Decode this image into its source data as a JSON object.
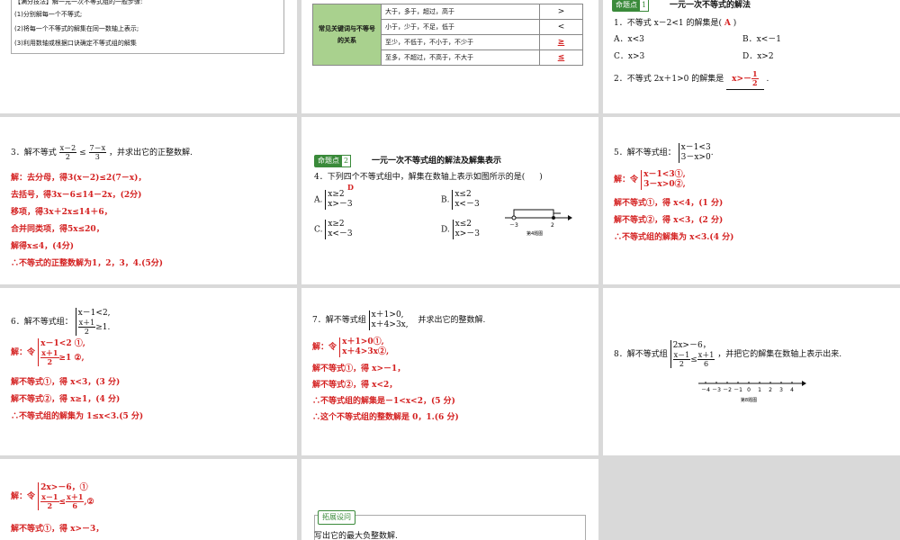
{
  "p1": {
    "items": [
      "【满分技法】解一元一次不等式组的一般步骤:",
      "(1)分别解每一个不等式;",
      "(2)将每一个不等式的解集在同一数轴上表示;",
      "(3)利用数轴或根据口诀确定不等式组的解集"
    ]
  },
  "p2": {
    "head": "常见关键词与不等号的关系",
    "rows": [
      {
        "words": "大于，多于，超过，高于",
        "sym": ">"
      },
      {
        "words": "小于，少于，不足，低于",
        "sym": "<"
      },
      {
        "words": "至少，不低于，不小于，不少于",
        "sym": "≥"
      },
      {
        "words": "至多，不超过，不高于，不大于",
        "sym": "≤"
      }
    ]
  },
  "p3": {
    "tag": "命题点",
    "tag_num": "1",
    "title": "一元一次不等式的解法",
    "q1": "1．不等式 x－2<1 的解集是(",
    "q1_ans": "A",
    "q1_end": ")",
    "optA": "A．x<3",
    "optB": "B．x<－1",
    "optC": "C．x>3",
    "optD": "D．x>2",
    "q2": "2．不等式 2x＋1>0 的解集是",
    "q2_ans_pre": "x>－",
    "q2_num": "1",
    "q2_den": "2",
    "q2_end": "."
  },
  "p4": {
    "q": "3．解不等式",
    "f1n": "x－2",
    "f1d": "2",
    "le": "≤",
    "f2n": "7－x",
    "f2d": "3",
    "q_end": "，并求出它的正整数解.",
    "lines": [
      "解：去分母，得3(x－2)≤2(7－x)，",
      "去括号，得3x－6≤14－2x，(2分)",
      "移项，得3x＋2x≤14＋6，",
      "合并同类项，得5x≤20，",
      "解得x≤4，(4分)",
      "∴不等式的正整数解为1，2，3，4.(5分)"
    ]
  },
  "p5": {
    "tag": "命题点",
    "tag_num": "2",
    "title": "一元一次不等式组的解法及解集表示",
    "q": "4．下列四个不等式组中，解集在数轴上表示如图所示的是(",
    "q_end": ")",
    "ans": "D",
    "A1": "x≥2",
    "A2": "x>－3",
    "B1": "x≤2",
    "B2": "x<－3",
    "C1": "x≥2",
    "C2": "x<－3",
    "D1": "x≤2",
    "D2": "x>－3",
    "la": "A.",
    "lb": "B.",
    "lc": "C.",
    "ld": "D.",
    "axis_l": "－3",
    "axis_r": "2",
    "fig": "第4题图"
  },
  "p6": {
    "q": "5．解不等式组：",
    "s1": "x－1<3",
    "s2": "3－x>0",
    "q_end": ".",
    "sol": "解：令",
    "s1r": "x－1<3①,",
    "s2r": "3－x>0②,",
    "lines": [
      "解不等式①，得 x<4，(1 分)",
      "解不等式②，得 x<3，(2 分)",
      "∴不等式组的解集为 x<3.(4 分)"
    ]
  },
  "p7": {
    "q": "6．解不等式组：",
    "s1": "x－1<2,",
    "fn": "x＋1",
    "fd": "2",
    "s2r": "≥1.",
    "sol": "解：令",
    "s1r": "x－1<2 ①,",
    "s2rr": "≥1 ②,",
    "lines": [
      "解不等式①，得 x<3，(3 分)",
      "解不等式②，得 x≥1，(4 分)",
      "∴不等式组的解集为 1≤x<3.(5 分)"
    ]
  },
  "p8": {
    "q": "7．解不等式组",
    "s1": "x＋1>0,",
    "s2": "x＋4>3x,",
    "q_end": "并求出它的整数解.",
    "sol": "解：令",
    "s1r": "x＋1>0①,",
    "s2r": "x＋4>3x②,",
    "lines": [
      "解不等式①，得 x>－1，",
      "解不等式②，得 x<2，",
      "∴不等式组的解集是－1<x<2，(5 分)",
      "∴这个不等式组的整数解是 0，1.(6 分)"
    ]
  },
  "p9": {
    "q": "8．解不等式组",
    "s1": "2x>－6，",
    "fn1": "x－1",
    "fd1": "2",
    "le": "≤",
    "fn2": "x＋1",
    "fd2": "6",
    "q_end": "，并把它的解集在数轴上表示出来.",
    "ticks": [
      "－4",
      "－3",
      "－2",
      "－1",
      "0",
      "1",
      "2",
      "3",
      "4"
    ],
    "fig": "第8题图"
  },
  "p10": {
    "sol": "解：令",
    "s1": "2x>－6，①",
    "fn1": "x－1",
    "fd1": "2",
    "le": "≤",
    "fn2": "x＋1",
    "fd2": "6",
    "s2end": ",②",
    "line1": "解不等式①，得 x>－3，"
  },
  "p11": {
    "tag": "拓展设问",
    "text": "写出它的最大负整数解."
  }
}
